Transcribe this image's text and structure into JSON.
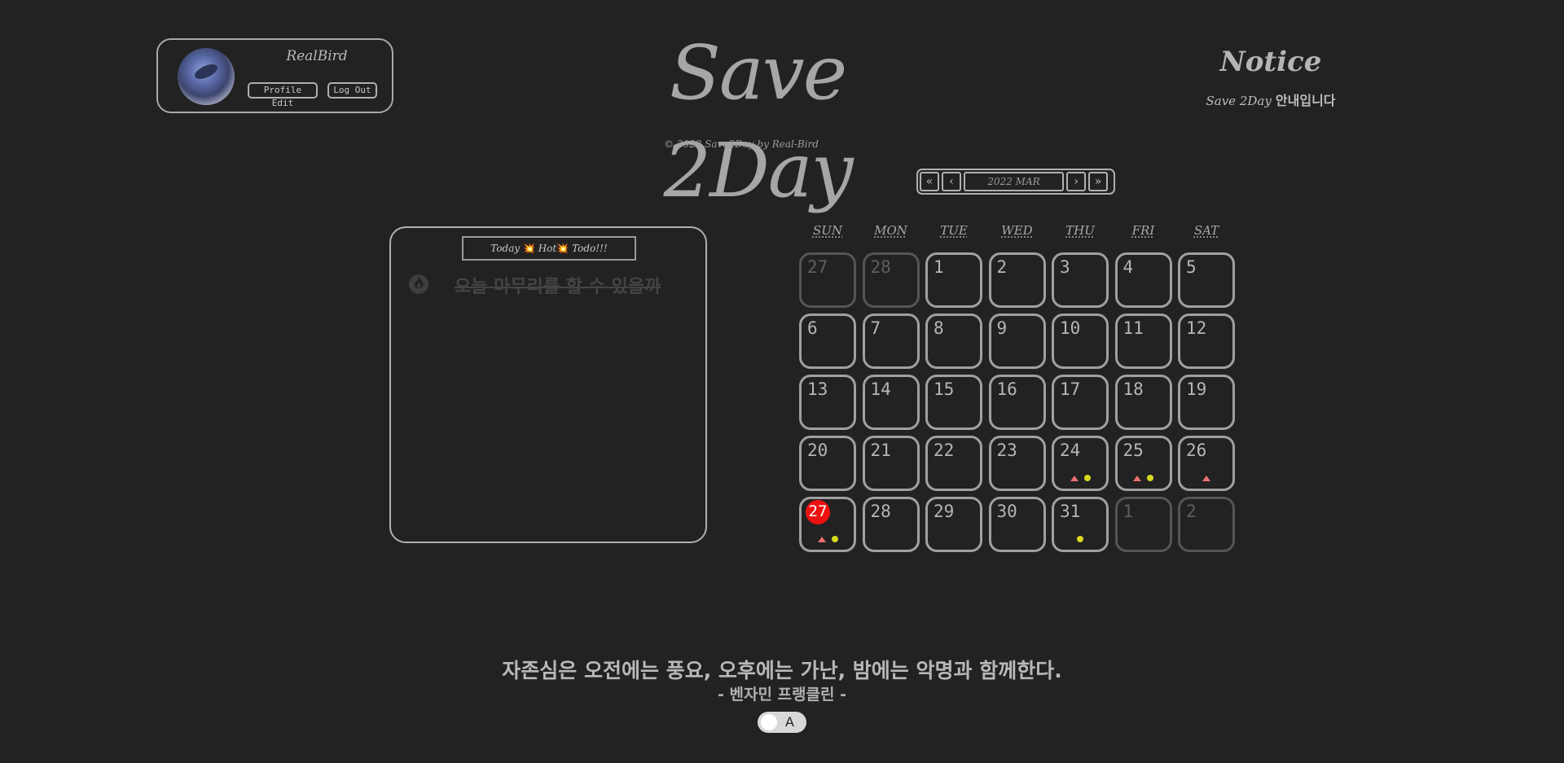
{
  "profile": {
    "name": "RealBird",
    "edit_label": "Profile Edit",
    "logout_label": "Log Out"
  },
  "app": {
    "title": "Save 2Day",
    "copyright": "© 2022 Save2Day by Real-Bird"
  },
  "notice": {
    "title": "Notice",
    "brand": "Save 2Day",
    "message": "안내입니다"
  },
  "month_nav": {
    "prev_year": "«",
    "prev_month": "‹",
    "label": "2022 MAR",
    "next_month": "›",
    "next_year": "»"
  },
  "todo": {
    "header_left": "Today",
    "header_hot": "Hot",
    "header_right": "Todo!!!",
    "spark": "💥",
    "items": [
      {
        "text": "오늘 마무리를 할 수 있을까",
        "done": true,
        "icon": "fire-icon"
      }
    ]
  },
  "calendar": {
    "weekdays": [
      "SUN",
      "MON",
      "TUE",
      "WED",
      "THU",
      "FRI",
      "SAT"
    ],
    "weeks": [
      [
        {
          "d": "27",
          "other": true
        },
        {
          "d": "28",
          "other": true
        },
        {
          "d": "1"
        },
        {
          "d": "2"
        },
        {
          "d": "3"
        },
        {
          "d": "4"
        },
        {
          "d": "5"
        }
      ],
      [
        {
          "d": "6"
        },
        {
          "d": "7"
        },
        {
          "d": "8"
        },
        {
          "d": "9"
        },
        {
          "d": "10"
        },
        {
          "d": "11"
        },
        {
          "d": "12"
        }
      ],
      [
        {
          "d": "13"
        },
        {
          "d": "14"
        },
        {
          "d": "15"
        },
        {
          "d": "16"
        },
        {
          "d": "17"
        },
        {
          "d": "18"
        },
        {
          "d": "19"
        }
      ],
      [
        {
          "d": "20"
        },
        {
          "d": "21"
        },
        {
          "d": "22"
        },
        {
          "d": "23"
        },
        {
          "d": "24",
          "tri": true,
          "dot": true
        },
        {
          "d": "25",
          "tri": true,
          "dot": true
        },
        {
          "d": "26",
          "tri": true
        }
      ],
      [
        {
          "d": "27",
          "today": true,
          "tri": true,
          "dot": true
        },
        {
          "d": "28"
        },
        {
          "d": "29"
        },
        {
          "d": "30"
        },
        {
          "d": "31",
          "dot": true
        },
        {
          "d": "1",
          "other": true
        },
        {
          "d": "2",
          "other": true
        }
      ]
    ],
    "colors": {
      "today": "#ee1111",
      "triangle": "#f07070",
      "dot": "#d8d820"
    }
  },
  "quote": {
    "text": "자존심은 오전에는 풍요, 오후에는 가난, 밤에는 악명과 함께한다.",
    "author": "- 벤자민 프랭클린 -"
  },
  "theme_toggle": {
    "label": "A"
  }
}
